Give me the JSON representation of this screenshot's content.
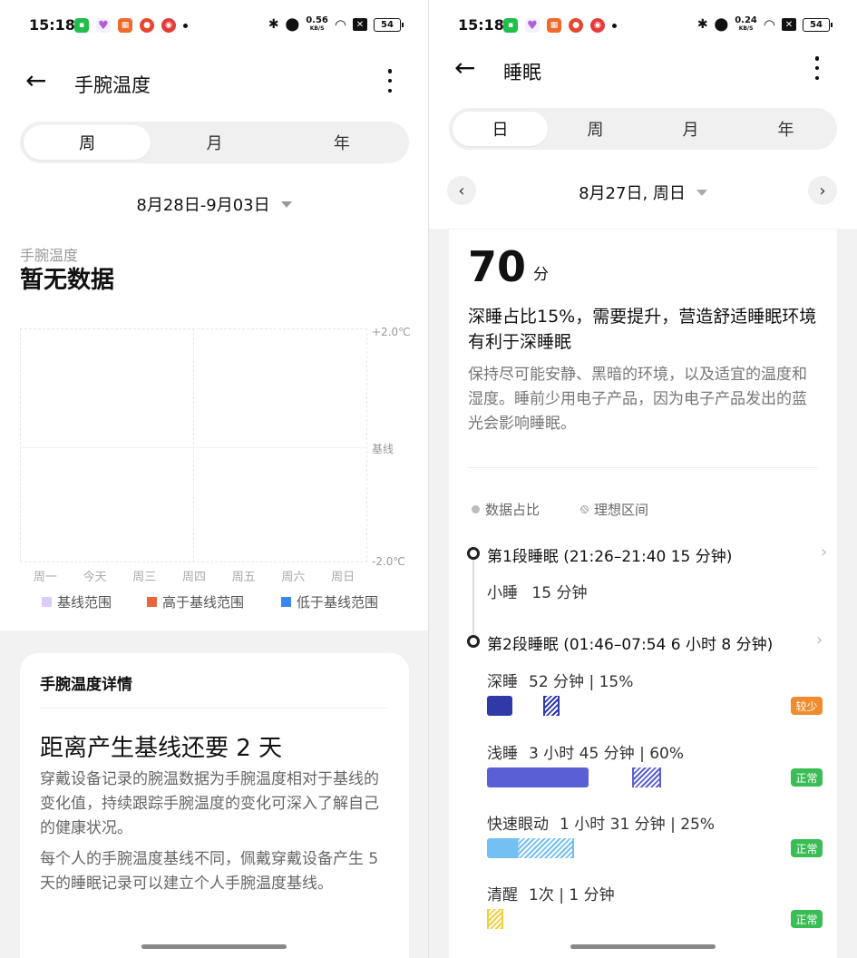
{
  "status_left": {
    "time": "15:18",
    "net_speed": "0.56",
    "net_unit": "KB/S",
    "battery": "54"
  },
  "status_right": {
    "time": "15:18",
    "net_speed": "0.24",
    "net_unit": "KB/S",
    "battery": "54"
  },
  "left": {
    "title": "手腕温度",
    "tabs": [
      "周",
      "月",
      "年"
    ],
    "active_tab": 0,
    "date_range": "8月28日-9月03日",
    "metric_label": "手腕温度",
    "no_data": "暂无数据",
    "chart_data": {
      "type": "line",
      "y_tick_labels": [
        "+2.0℃",
        "基线",
        "-2.0℃"
      ],
      "x_labels": [
        "周一",
        "今天",
        "周三",
        "周四",
        "周五",
        "周六",
        "周日"
      ],
      "series": [],
      "legend": [
        {
          "label": "基线范围",
          "color": "#d8cef7"
        },
        {
          "label": "高于基线范围",
          "color": "#e8653f"
        },
        {
          "label": "低于基线范围",
          "color": "#3a86f0"
        }
      ]
    },
    "detail": {
      "title": "手腕温度详情",
      "heading": "距离产生基线还要 2 天",
      "p1": "穿戴设备记录的腕温数据为手腕温度相对于基线的变化值，持续跟踪手腕温度的变化可深入了解自己的健康状况。",
      "p2": "每个人的手腕温度基线不同，佩戴穿戴设备产生 5 天的睡眠记录可以建立个人手腕温度基线。"
    }
  },
  "right": {
    "title": "睡眠",
    "tabs": [
      "日",
      "周",
      "月",
      "年"
    ],
    "active_tab": 0,
    "date": "8月27日, 周日",
    "score": "70",
    "score_unit": "分",
    "headline": "深睡占比15%，需要提升，营造舒适睡眠环境有利于深睡眠",
    "advice": "保持尽可能安静、黑暗的环境，以及适宜的温度和湿度。睡前少用电子产品，因为电子产品发出的蓝光会影响睡眠。",
    "legend": {
      "data_ratio": "数据占比",
      "ideal_range": "理想区间"
    },
    "segment1": {
      "title": "第1段睡眠 (21:26–21:40  15 分钟)",
      "type": "小睡",
      "duration": "15 分钟"
    },
    "segment2": {
      "title": "第2段睡眠 (01:46–07:54  6 小时 8 分钟)"
    },
    "stages": [
      {
        "name": "深睡",
        "detail": "52 分钟 | 15%",
        "status": "较少",
        "status_color": "#f08c2e",
        "color": "#2f3aa8",
        "ratio": 0.15
      },
      {
        "name": "浅睡",
        "detail": "3 小时 45 分钟 | 60%",
        "status": "正常",
        "status_color": "#3bbd55",
        "color": "#5a5fd6",
        "ratio": 0.6
      },
      {
        "name": "快速眼动",
        "detail": "1 小时 31 分钟 | 25%",
        "status": "正常",
        "status_color": "#3bbd55",
        "color": "#74c0f2",
        "ratio": 0.25
      },
      {
        "name": "清醒",
        "detail": "1次 |  1 分钟",
        "status": "正常",
        "status_color": "#3bbd55",
        "color": "#f2cf3b",
        "ratio": 0.0
      }
    ]
  }
}
